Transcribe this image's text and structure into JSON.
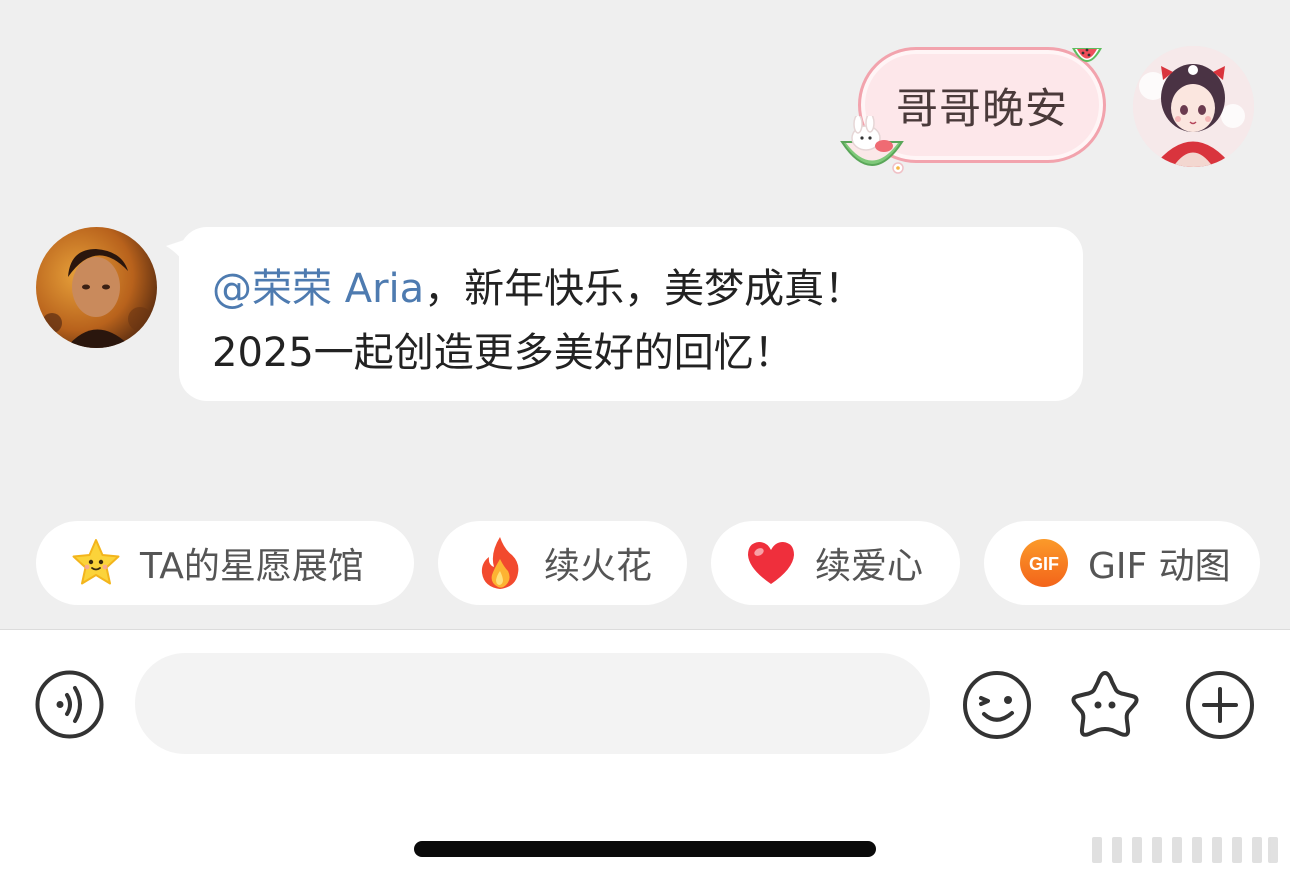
{
  "outgoing_message": {
    "text": "哥哥晚安"
  },
  "incoming_message": {
    "mention": "@荣荣 Aria",
    "line1_rest": "，新年快乐，美梦成真！",
    "line2": "2025一起创造更多美好的回忆！"
  },
  "quick_actions": [
    {
      "label": "TA的星愿展馆",
      "icon": "star-face-icon"
    },
    {
      "label": "续火花",
      "icon": "fire-icon"
    },
    {
      "label": "续爱心",
      "icon": "heart-icon"
    },
    {
      "label": "GIF 动图",
      "icon": "gif-icon",
      "icon_text": "GIF"
    }
  ],
  "input": {
    "value": "",
    "placeholder": ""
  },
  "colors": {
    "chat_background": "#efefef",
    "mention": "#4e7bb0",
    "outgoing_bubble": "#fde7ea",
    "outgoing_border": "#f2a3ad"
  }
}
